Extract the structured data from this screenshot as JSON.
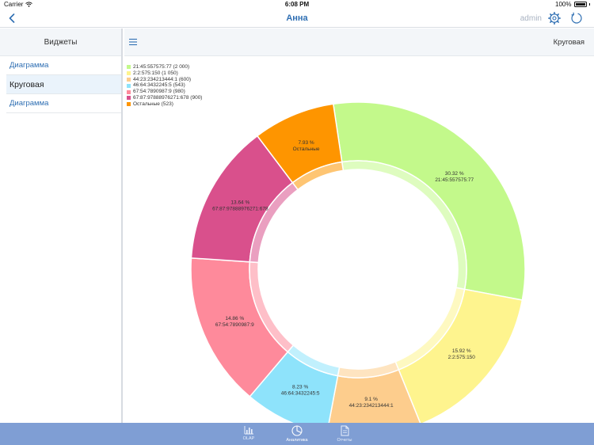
{
  "status": {
    "carrier": "Carrier",
    "time": "6:08 PM",
    "battery": "100%"
  },
  "nav": {
    "title": "Анна",
    "user": "admin"
  },
  "sidebar": {
    "title": "Виджеты",
    "items": [
      {
        "label": "Диаграмма"
      },
      {
        "label": "Круговая"
      },
      {
        "label": "Диаграмма"
      }
    ]
  },
  "detail": {
    "title": "Круговая"
  },
  "chart_data": {
    "type": "pie",
    "variant": "donut",
    "series": [
      {
        "name": "21:45:557575:77",
        "count": "2 000",
        "value": 30.32,
        "label": "30.32 %",
        "color": "#c3f98b"
      },
      {
        "name": "2:2:575:150",
        "count": "1 050",
        "value": 15.92,
        "label": "15.92 %",
        "color": "#fef48e"
      },
      {
        "name": "44:23:234213444:1",
        "count": "600",
        "value": 9.1,
        "label": "9.1 %",
        "color": "#fdcd8d"
      },
      {
        "name": "46:64:3432245:5",
        "count": "543",
        "value": 8.23,
        "label": "8.23 %",
        "color": "#8ee3fb"
      },
      {
        "name": "67:54:7890987:9",
        "count": "980",
        "value": 14.86,
        "label": "14.86 %",
        "color": "#fe8a9b"
      },
      {
        "name": "67:87:97888976271:678",
        "count": "900",
        "value": 13.64,
        "label": "13.64 %",
        "color": "#d9508c"
      },
      {
        "name": "Остальные",
        "count": "523",
        "value": 7.93,
        "label": "7.93 %",
        "color": "#fe9500"
      }
    ],
    "legend_position": "top-left"
  },
  "tabs": [
    {
      "label": "OLAP",
      "icon": "chart-icon"
    },
    {
      "label": "Аналитика",
      "icon": "pie-icon"
    },
    {
      "label": "Отчеты",
      "icon": "document-icon"
    }
  ],
  "colors": {
    "accent": "#2f6fb3",
    "tabbar": "#7f9ed4",
    "header_bg": "#f3f6f9"
  }
}
